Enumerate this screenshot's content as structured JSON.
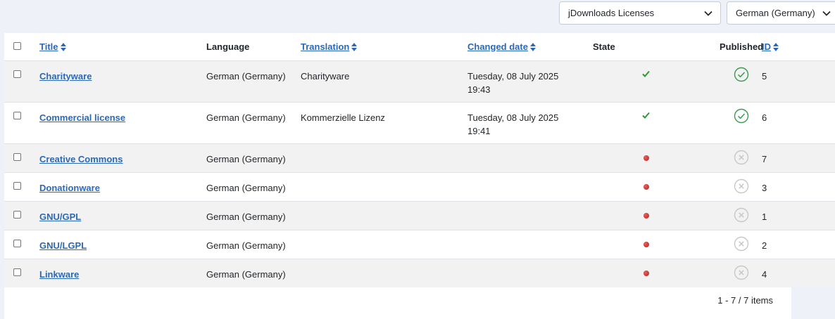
{
  "filters": {
    "type_select": "jDownloads Licenses",
    "language_select": "German (Germany)"
  },
  "columns": {
    "title": "Title",
    "language": "Language",
    "translation": "Translation",
    "changed": "Changed date",
    "state": "State",
    "published": "Published",
    "id": "ID"
  },
  "rows": [
    {
      "title": "Charityware",
      "language": "German (Germany)",
      "translation": "Charityware",
      "date": "Tuesday, 08 July 2025",
      "time": "19:43",
      "state": "translated",
      "published": true,
      "id": "5"
    },
    {
      "title": "Commercial license",
      "language": "German (Germany)",
      "translation": "Kommerzielle Lizenz",
      "date": "Tuesday, 08 July 2025",
      "time": "19:41",
      "state": "translated",
      "published": true,
      "id": "6"
    },
    {
      "title": "Creative Commons",
      "language": "German (Germany)",
      "translation": "",
      "date": "",
      "time": "",
      "state": "missing",
      "published": false,
      "id": "7"
    },
    {
      "title": "Donationware",
      "language": "German (Germany)",
      "translation": "",
      "date": "",
      "time": "",
      "state": "missing",
      "published": false,
      "id": "3"
    },
    {
      "title": "GNU/GPL",
      "language": "German (Germany)",
      "translation": "",
      "date": "",
      "time": "",
      "state": "missing",
      "published": false,
      "id": "1"
    },
    {
      "title": "GNU/LGPL",
      "language": "German (Germany)",
      "translation": "",
      "date": "",
      "time": "",
      "state": "missing",
      "published": false,
      "id": "2"
    },
    {
      "title": "Linkware",
      "language": "German (Germany)",
      "translation": "",
      "date": "",
      "time": "",
      "state": "missing",
      "published": false,
      "id": "4"
    }
  ],
  "pagination": {
    "summary": "1 - 7 / 7 items"
  },
  "colors": {
    "link": "#2a69b8",
    "published": "#3a9a52",
    "unpublished": "#c8c8c8",
    "state_ok": "#2e9a2e",
    "state_missing": "#c0282a"
  }
}
